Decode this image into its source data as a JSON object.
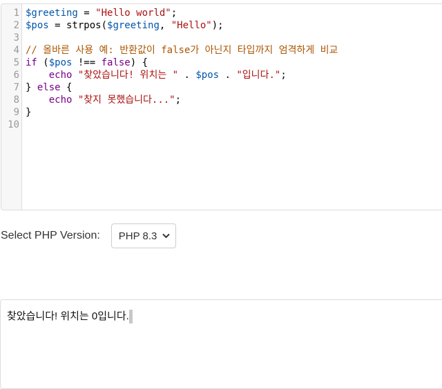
{
  "editor": {
    "line_numbers": [
      "1",
      "2",
      "3",
      "4",
      "5",
      "6",
      "7",
      "8",
      "9",
      "10"
    ],
    "lines": [
      [
        {
          "t": "$greeting",
          "c": "var"
        },
        {
          "t": " = ",
          "c": "plain"
        },
        {
          "t": "\"Hello world\"",
          "c": "str"
        },
        {
          "t": ";",
          "c": "plain"
        }
      ],
      [
        {
          "t": "$pos",
          "c": "var"
        },
        {
          "t": " = strpos(",
          "c": "plain"
        },
        {
          "t": "$greeting",
          "c": "var"
        },
        {
          "t": ", ",
          "c": "plain"
        },
        {
          "t": "\"Hello\"",
          "c": "str"
        },
        {
          "t": ");",
          "c": "plain"
        }
      ],
      [],
      [
        {
          "t": "// 올바른 사용 예: 반환값이 false가 아닌지 타입까지 엄격하게 비교",
          "c": "cm"
        }
      ],
      [
        {
          "t": "if",
          "c": "kw"
        },
        {
          "t": " (",
          "c": "plain"
        },
        {
          "t": "$pos",
          "c": "var"
        },
        {
          "t": " !== ",
          "c": "plain"
        },
        {
          "t": "false",
          "c": "kw"
        },
        {
          "t": ") {",
          "c": "plain"
        }
      ],
      [
        {
          "t": "    ",
          "c": "plain"
        },
        {
          "t": "echo",
          "c": "kw"
        },
        {
          "t": " ",
          "c": "plain"
        },
        {
          "t": "\"찾았습니다! 위치는 \"",
          "c": "str"
        },
        {
          "t": " . ",
          "c": "plain"
        },
        {
          "t": "$pos",
          "c": "var"
        },
        {
          "t": " . ",
          "c": "plain"
        },
        {
          "t": "\"입니다.\"",
          "c": "str"
        },
        {
          "t": ";",
          "c": "plain"
        }
      ],
      [
        {
          "t": "} ",
          "c": "plain"
        },
        {
          "t": "else",
          "c": "kw"
        },
        {
          "t": " {",
          "c": "plain"
        }
      ],
      [
        {
          "t": "    ",
          "c": "plain"
        },
        {
          "t": "echo",
          "c": "kw"
        },
        {
          "t": " ",
          "c": "plain"
        },
        {
          "t": "\"찾지 못했습니다...\"",
          "c": "str"
        },
        {
          "t": ";",
          "c": "plain"
        }
      ],
      [
        {
          "t": "}",
          "c": "plain"
        }
      ],
      []
    ]
  },
  "version": {
    "label": "Select PHP Version:",
    "selected": "PHP 8.3"
  },
  "output": {
    "text": "찾았습니다! 위치는 0입니다."
  }
}
